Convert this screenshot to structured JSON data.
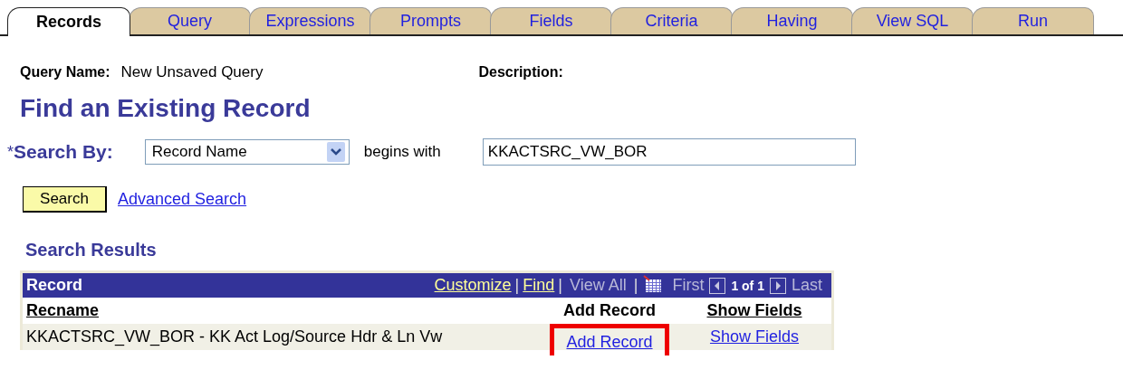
{
  "tabs": [
    {
      "label": "Records",
      "selected": true
    },
    {
      "label": "Query",
      "selected": false
    },
    {
      "label": "Expressions",
      "selected": false
    },
    {
      "label": "Prompts",
      "selected": false
    },
    {
      "label": "Fields",
      "selected": false
    },
    {
      "label": "Criteria",
      "selected": false
    },
    {
      "label": "Having",
      "selected": false
    },
    {
      "label": "View SQL",
      "selected": false
    },
    {
      "label": "Run",
      "selected": false
    }
  ],
  "query_name": {
    "label": "Query Name:",
    "value": "New Unsaved Query"
  },
  "description": {
    "label": "Description:"
  },
  "heading": "Find an Existing Record",
  "search_by": {
    "required_mark": "*",
    "label": "Search By:",
    "field": "Record Name",
    "operator": "begins with",
    "value": "KKACTSRC_VW_BOR"
  },
  "search_button": "Search",
  "advanced_search": "Advanced Search",
  "results": {
    "title": "Search Results",
    "grid_title": "Record",
    "links": [
      "Customize",
      "Find"
    ],
    "view_all": "View All",
    "separator": "|",
    "first": "First",
    "range": "1 of 1",
    "last": "Last",
    "columns": [
      "Recname",
      "Add Record",
      "Show Fields"
    ],
    "rows": [
      {
        "recname": "KKACTSRC_VW_BOR - KK Act Log/Source Hdr & Ln Vw",
        "add": "Add Record",
        "show": "Show Fields",
        "highlighted": true
      }
    ]
  }
}
